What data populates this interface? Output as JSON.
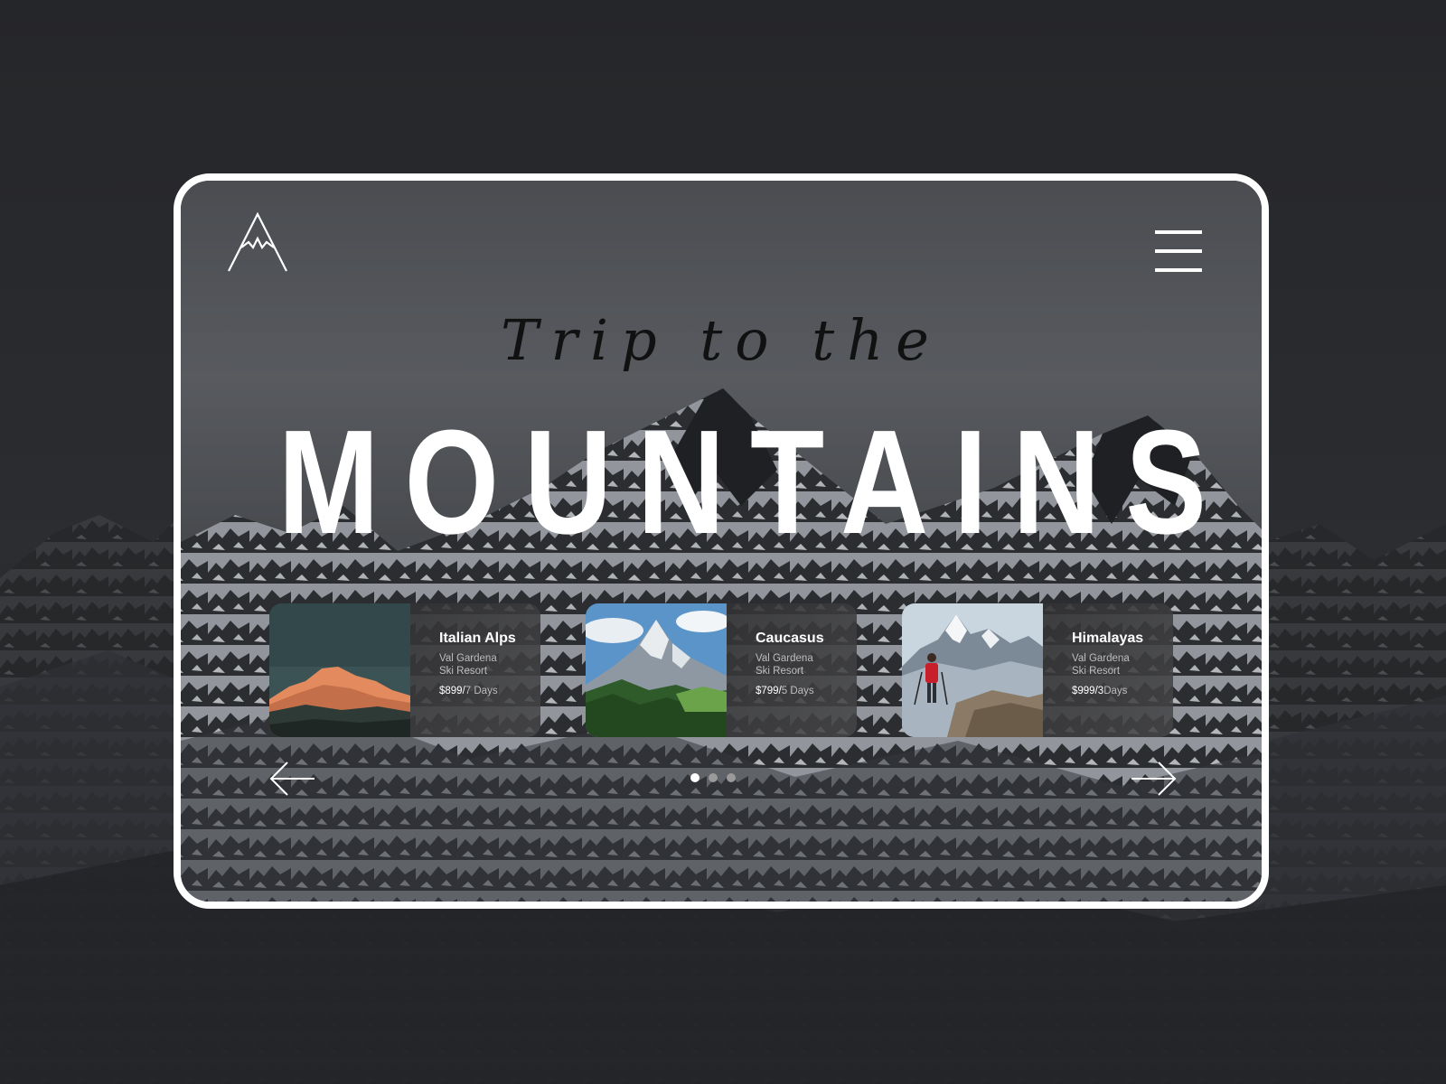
{
  "hero": {
    "subtitle": "Trip to the",
    "title": "MOUNTAINS"
  },
  "header": {
    "logo_icon": "mountain-logo-icon",
    "menu_icon": "hamburger-menu-icon"
  },
  "destinations": [
    {
      "name": "Italian Alps",
      "location_line1": "Val Gardena",
      "location_line2": "Ski Resort",
      "price": "$899/",
      "duration": "7 Days"
    },
    {
      "name": "Caucasus",
      "location_line1": "Val Gardena",
      "location_line2": "Ski Resort",
      "price": "$799/",
      "duration": "5 Days"
    },
    {
      "name": "Himalayas",
      "location_line1": "Val Gardena",
      "location_line2": "Ski Resort",
      "price": "$999/3",
      "duration": "Days"
    }
  ],
  "carousel": {
    "prev_icon": "arrow-left-icon",
    "next_icon": "arrow-right-icon",
    "page_count": 3,
    "active_page": 1
  },
  "colors": {
    "background": "#2b2d31",
    "frame_border": "#ffffff",
    "title": "#ffffff",
    "subtitle": "#111111",
    "dot_active": "#ffffff",
    "dot_inactive": "#9a9a9a"
  }
}
